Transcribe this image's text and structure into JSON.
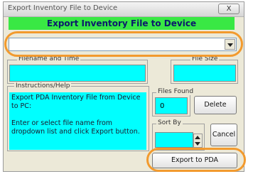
{
  "window": {
    "title": "Export Inventory File to Device",
    "close_label": "X"
  },
  "header": {
    "title": "Export Inventory File to Device"
  },
  "file_combo": {
    "value": ""
  },
  "fields": {
    "filename_label": "Filename and Time",
    "filesize_label": "File Size",
    "files_found_label": "Files Found",
    "files_found_value": "0",
    "sort_by_label": "Sort By",
    "sort_by_value": ""
  },
  "help": {
    "label": "Instructions/Help",
    "text": "Export PDA Inventory File from Device to PC:\n\nEnter or select file name from dropdown list and click Export button."
  },
  "buttons": {
    "delete": "Delete",
    "cancel": "Cancel",
    "export": "Export to PDA"
  },
  "colors": {
    "header": "#39e844",
    "field_bg": "#00ffff",
    "highlight": "#f29a2e",
    "dialog_bg": "#ece9d8"
  }
}
